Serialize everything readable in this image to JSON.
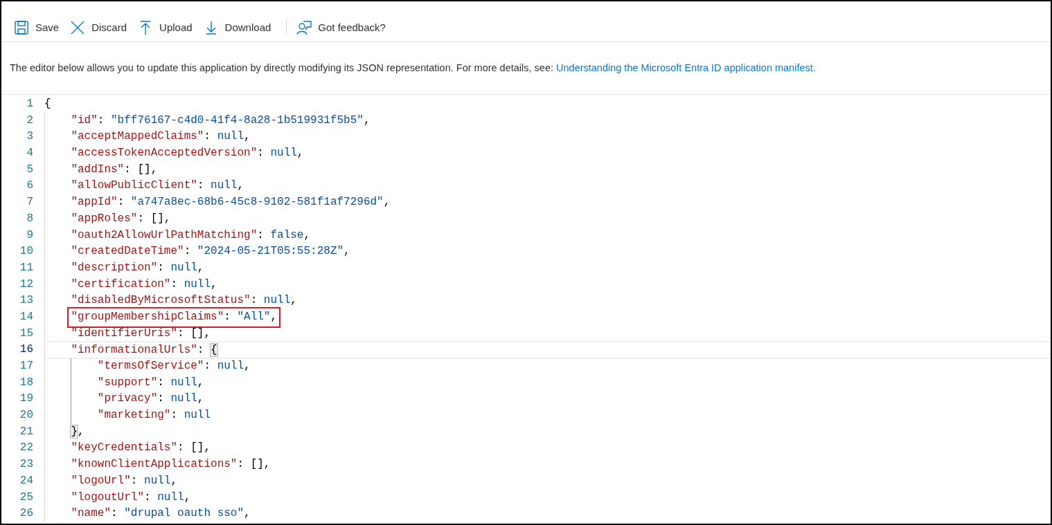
{
  "toolbar": [
    {
      "kind": "save",
      "label": "Save"
    },
    {
      "kind": "discard",
      "label": "Discard"
    },
    {
      "kind": "upload",
      "label": "Upload"
    },
    {
      "kind": "download",
      "label": "Download"
    },
    {
      "kind": "feedback",
      "label": "Got feedback?"
    }
  ],
  "info": {
    "text": "The editor below allows you to update this application by directly modifying its JSON representation. For more details, see:",
    "link": "Understanding the Microsoft Entra ID application manifest."
  },
  "editor": {
    "lines": [
      {
        "number": "1",
        "current": false,
        "boxed": false,
        "tokens": [
          {
            "kind": "punct",
            "text": "{"
          }
        ],
        "children": [
          {
            "number": "2",
            "current": false,
            "boxed": false,
            "tokens": [
              {
                "kind": "key",
                "text": "\"id\""
              },
              {
                "kind": "punct",
                "text": ": "
              },
              {
                "kind": "string",
                "text": "\"bff76167-c4d0-41f4-8a28-1b519931f5b5\""
              },
              {
                "kind": "punct",
                "text": ","
              }
            ]
          },
          {
            "number": "3",
            "current": false,
            "boxed": false,
            "tokens": [
              {
                "kind": "key",
                "text": "\"acceptMappedClaims\""
              },
              {
                "kind": "punct",
                "text": ": "
              },
              {
                "kind": "literal",
                "text": "null"
              },
              {
                "kind": "punct",
                "text": ","
              }
            ]
          },
          {
            "number": "4",
            "current": false,
            "boxed": false,
            "tokens": [
              {
                "kind": "key",
                "text": "\"accessTokenAcceptedVersion\""
              },
              {
                "kind": "punct",
                "text": ": "
              },
              {
                "kind": "literal",
                "text": "null"
              },
              {
                "kind": "punct",
                "text": ","
              }
            ]
          },
          {
            "number": "5",
            "current": false,
            "boxed": false,
            "tokens": [
              {
                "kind": "key",
                "text": "\"addIns\""
              },
              {
                "kind": "punct",
                "text": ": [],"
              }
            ]
          },
          {
            "number": "6",
            "current": false,
            "boxed": false,
            "tokens": [
              {
                "kind": "key",
                "text": "\"allowPublicClient\""
              },
              {
                "kind": "punct",
                "text": ": "
              },
              {
                "kind": "literal",
                "text": "null"
              },
              {
                "kind": "punct",
                "text": ","
              }
            ]
          },
          {
            "number": "7",
            "current": false,
            "boxed": false,
            "tokens": [
              {
                "kind": "key",
                "text": "\"appId\""
              },
              {
                "kind": "punct",
                "text": ": "
              },
              {
                "kind": "string",
                "text": "\"a747a8ec-68b6-45c8-9102-581f1af7296d\""
              },
              {
                "kind": "punct",
                "text": ","
              }
            ]
          },
          {
            "number": "8",
            "current": false,
            "boxed": false,
            "tokens": [
              {
                "kind": "key",
                "text": "\"appRoles\""
              },
              {
                "kind": "punct",
                "text": ": [],"
              }
            ]
          },
          {
            "number": "9",
            "current": false,
            "boxed": false,
            "tokens": [
              {
                "kind": "key",
                "text": "\"oauth2AllowUrlPathMatching\""
              },
              {
                "kind": "punct",
                "text": ": "
              },
              {
                "kind": "literal",
                "text": "false"
              },
              {
                "kind": "punct",
                "text": ","
              }
            ]
          },
          {
            "number": "10",
            "current": false,
            "boxed": false,
            "tokens": [
              {
                "kind": "key",
                "text": "\"createdDateTime\""
              },
              {
                "kind": "punct",
                "text": ": "
              },
              {
                "kind": "string",
                "text": "\"2024-05-21T05:55:28Z\""
              },
              {
                "kind": "punct",
                "text": ","
              }
            ]
          },
          {
            "number": "11",
            "current": false,
            "boxed": false,
            "tokens": [
              {
                "kind": "key",
                "text": "\"description\""
              },
              {
                "kind": "punct",
                "text": ": "
              },
              {
                "kind": "literal",
                "text": "null"
              },
              {
                "kind": "punct",
                "text": ","
              }
            ]
          },
          {
            "number": "12",
            "current": false,
            "boxed": false,
            "tokens": [
              {
                "kind": "key",
                "text": "\"certification\""
              },
              {
                "kind": "punct",
                "text": ": "
              },
              {
                "kind": "literal",
                "text": "null"
              },
              {
                "kind": "punct",
                "text": ","
              }
            ]
          },
          {
            "number": "13",
            "current": false,
            "boxed": false,
            "tokens": [
              {
                "kind": "key",
                "text": "\"disabledByMicrosoftStatus\""
              },
              {
                "kind": "punct",
                "text": ": "
              },
              {
                "kind": "literal",
                "text": "null"
              },
              {
                "kind": "punct",
                "text": ","
              }
            ]
          },
          {
            "number": "14",
            "current": false,
            "boxed": true,
            "tokens": [
              {
                "kind": "key",
                "text": "\"groupMembershipClaims\""
              },
              {
                "kind": "punct",
                "text": ": "
              },
              {
                "kind": "string",
                "text": "\"All\""
              },
              {
                "kind": "punct",
                "text": ","
              }
            ]
          },
          {
            "number": "15",
            "current": false,
            "boxed": false,
            "tokens": [
              {
                "kind": "key",
                "text": "\"identifierUris\""
              },
              {
                "kind": "punct",
                "text": ": [],"
              }
            ]
          },
          {
            "number": "16",
            "current": true,
            "boxed": false,
            "tokens": [
              {
                "kind": "key",
                "text": "\"informationalUrls\""
              },
              {
                "kind": "punct",
                "text": ": "
              },
              {
                "kind": "matched",
                "text": "{"
              }
            ],
            "children": [
              {
                "number": "17",
                "current": false,
                "boxed": false,
                "tokens": [
                  {
                    "kind": "key",
                    "text": "\"termsOfService\""
                  },
                  {
                    "kind": "punct",
                    "text": ": "
                  },
                  {
                    "kind": "literal",
                    "text": "null"
                  },
                  {
                    "kind": "punct",
                    "text": ","
                  }
                ]
              },
              {
                "number": "18",
                "current": false,
                "boxed": false,
                "tokens": [
                  {
                    "kind": "key",
                    "text": "\"support\""
                  },
                  {
                    "kind": "punct",
                    "text": ": "
                  },
                  {
                    "kind": "literal",
                    "text": "null"
                  },
                  {
                    "kind": "punct",
                    "text": ","
                  }
                ]
              },
              {
                "number": "19",
                "current": false,
                "boxed": false,
                "tokens": [
                  {
                    "kind": "key",
                    "text": "\"privacy\""
                  },
                  {
                    "kind": "punct",
                    "text": ": "
                  },
                  {
                    "kind": "literal",
                    "text": "null"
                  },
                  {
                    "kind": "punct",
                    "text": ","
                  }
                ]
              },
              {
                "number": "20",
                "current": false,
                "boxed": false,
                "tokens": [
                  {
                    "kind": "key",
                    "text": "\"marketing\""
                  },
                  {
                    "kind": "punct",
                    "text": ": "
                  },
                  {
                    "kind": "literal",
                    "text": "null"
                  }
                ]
              }
            ]
          },
          {
            "number": "21",
            "current": false,
            "boxed": false,
            "tokens": [
              {
                "kind": "matched",
                "text": "}"
              },
              {
                "kind": "punct",
                "text": ","
              }
            ]
          },
          {
            "number": "22",
            "current": false,
            "boxed": false,
            "tokens": [
              {
                "kind": "key",
                "text": "\"keyCredentials\""
              },
              {
                "kind": "punct",
                "text": ": [],"
              }
            ]
          },
          {
            "number": "23",
            "current": false,
            "boxed": false,
            "tokens": [
              {
                "kind": "key",
                "text": "\"knownClientApplications\""
              },
              {
                "kind": "punct",
                "text": ": [],"
              }
            ]
          },
          {
            "number": "24",
            "current": false,
            "boxed": false,
            "tokens": [
              {
                "kind": "key",
                "text": "\"logoUrl\""
              },
              {
                "kind": "punct",
                "text": ": "
              },
              {
                "kind": "literal",
                "text": "null"
              },
              {
                "kind": "punct",
                "text": ","
              }
            ]
          },
          {
            "number": "25",
            "current": false,
            "boxed": false,
            "tokens": [
              {
                "kind": "key",
                "text": "\"logoutUrl\""
              },
              {
                "kind": "punct",
                "text": ": "
              },
              {
                "kind": "literal",
                "text": "null"
              },
              {
                "kind": "punct",
                "text": ","
              }
            ]
          },
          {
            "number": "26",
            "current": false,
            "boxed": false,
            "tokens": [
              {
                "kind": "key",
                "text": "\"name\""
              },
              {
                "kind": "punct",
                "text": ": "
              },
              {
                "kind": "string",
                "text": "\"drupal oauth sso\""
              },
              {
                "kind": "punct",
                "text": ","
              }
            ]
          }
        ]
      }
    ]
  }
}
